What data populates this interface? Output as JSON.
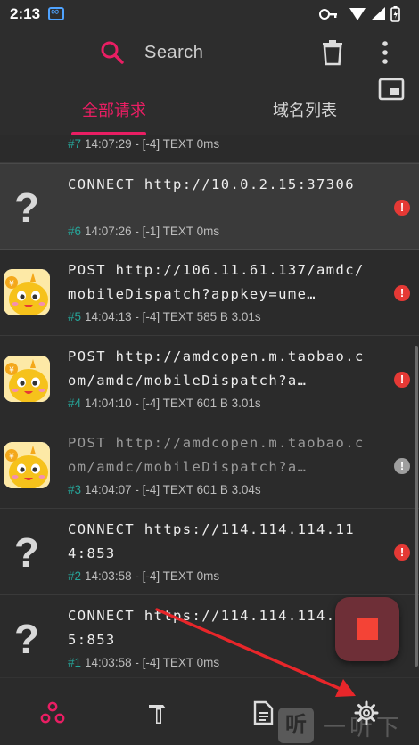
{
  "status_bar": {
    "time": "2:13"
  },
  "app_bar": {
    "search_placeholder": "Search",
    "tabs": [
      {
        "label": "全部请求",
        "active": true
      },
      {
        "label": "域名列表",
        "active": false
      }
    ]
  },
  "requests": [
    {
      "url": "CONNECT http://10.0.2.15:37306",
      "index": "#6",
      "meta": "14:07:26 - [-1] TEXT  0ms",
      "icon": "unknown-app-icon",
      "status": "error",
      "selected": true
    },
    {
      "url": "POST http://106.11.61.137/amdc/mobileDispatch?appkey=ume…",
      "index": "#5",
      "meta": "14:04:13 - [-4] TEXT 585 B 3.01s",
      "icon": "cartoon-app-icon",
      "status": "error"
    },
    {
      "url": "POST http://amdcopen.m.taobao.com/amdc/mobileDispatch?a…",
      "index": "#4",
      "meta": "14:04:10 - [-4] TEXT 601 B 3.01s",
      "icon": "cartoon-app-icon",
      "status": "error"
    },
    {
      "url": "POST http://amdcopen.m.taobao.com/amdc/mobileDispatch?a…",
      "index": "#3",
      "meta": "14:04:07 - [-4] TEXT 601 B 3.04s",
      "icon": "cartoon-app-icon",
      "status": "info",
      "dim": true
    },
    {
      "url": "CONNECT https://114.114.114.114:853",
      "index": "#2",
      "meta": "14:03:58 - [-4] TEXT  0ms",
      "icon": "unknown-app-icon",
      "status": "error"
    },
    {
      "url": "CONNECT https://114.114.114.115:853",
      "index": "#1",
      "meta": "14:03:58 - [-4] TEXT  0ms",
      "icon": "unknown-app-icon",
      "status": "error"
    }
  ],
  "partial_top_row": {
    "index": "#7",
    "meta": "14:07:29 - [-4] TEXT  0ms"
  },
  "unknown_glyph": "?",
  "status_glyph": "!",
  "watermark": {
    "logo": "听",
    "text": "一听下载"
  },
  "colors": {
    "accent": "#e91e63",
    "error": "#e53935",
    "index_teal": "#26a69a",
    "fab_bg": "#6e2f37",
    "annotation_arrow": "#e8262a"
  }
}
